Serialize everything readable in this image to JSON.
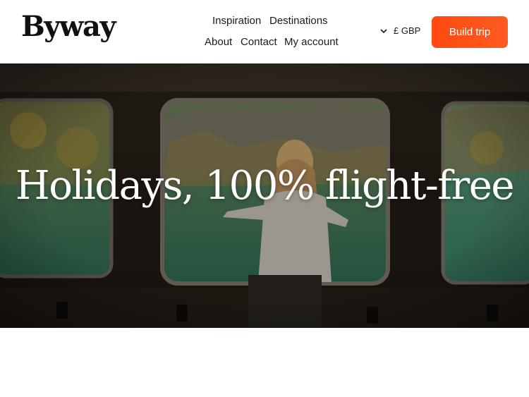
{
  "brand": {
    "logo_text": "Byway"
  },
  "nav": {
    "row1": [
      "Inspiration",
      "Destinations"
    ],
    "row2": [
      "About",
      "Contact",
      "My account"
    ]
  },
  "currency": {
    "label": "£ GBP",
    "icon": "chevron-down-icon"
  },
  "cta": {
    "label": "Build trip",
    "color": "#ff5014"
  },
  "hero": {
    "title": "Holidays, 100% flight-free"
  }
}
